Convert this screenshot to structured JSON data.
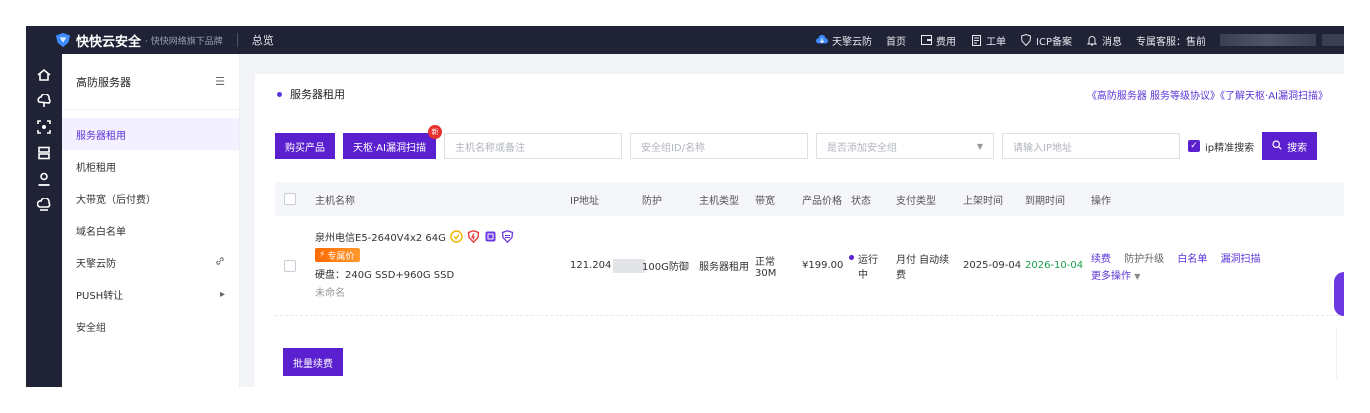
{
  "topbar": {
    "brand": "快快云安全",
    "brand_sub": "· 快快网络旗下品牌",
    "breadcrumb": "总览",
    "nav": [
      {
        "label": "天擎云防",
        "icon": "cloud-icon"
      },
      {
        "label": "首页",
        "icon": ""
      },
      {
        "label": "费用",
        "icon": "wallet-icon"
      },
      {
        "label": "工单",
        "icon": "doc-icon"
      },
      {
        "label": "ICP备案",
        "icon": "shield-icon"
      },
      {
        "label": "消息",
        "icon": "bell-icon"
      }
    ],
    "service_label": "专属客服：",
    "service_prefix": "售前"
  },
  "menu": {
    "title": "高防服务器",
    "items": [
      {
        "label": "服务器租用",
        "active": true,
        "suffix": ""
      },
      {
        "label": "机柜租用",
        "active": false,
        "suffix": ""
      },
      {
        "label": "大带宽（后付费）",
        "active": false,
        "suffix": ""
      },
      {
        "label": "域名白名单",
        "active": false,
        "suffix": ""
      },
      {
        "label": "天擎云防",
        "active": false,
        "suffix": "link"
      },
      {
        "label": "PUSH转让",
        "active": false,
        "suffix": "arrow"
      },
      {
        "label": "安全组",
        "active": false,
        "suffix": ""
      }
    ]
  },
  "section": {
    "title": "服务器租用",
    "links": "《高防服务器 服务等级协议》《了解天枢·AI漏洞扫描》"
  },
  "toolbar": {
    "buy_label": "购买产品",
    "scan_label": "天枢·AI漏洞扫描",
    "new_badge": "新",
    "host_placeholder": "主机名称或备注",
    "group_placeholder": "安全组ID/名称",
    "group_select": "是否添加安全组",
    "ip_placeholder": "请输入IP地址",
    "exact_label": "ip精准搜索",
    "search_label": "搜索"
  },
  "table": {
    "headers": [
      "主机名称",
      "IP地址",
      "防护",
      "主机类型",
      "带宽",
      "产品价格",
      "状态",
      "支付类型",
      "上架时间",
      "到期时间",
      "操作"
    ],
    "rows": [
      {
        "name": "泉州电信E5-2640V4x2 64G",
        "promo": "专属价",
        "disk": "硬盘：240G SSD+960G SSD",
        "remark": "未命名",
        "ip": "121.204",
        "defense": "100G防御",
        "type": "服务器租用",
        "bandwidth_1": "正常",
        "bandwidth_2": "30M",
        "price": "¥199.00",
        "status_1": "运行",
        "status_2": "中",
        "pay_1": "月付 自动续",
        "pay_2": "费",
        "start": "2025-09-04",
        "expire": "2026-10-04",
        "ops": [
          "续费",
          "防护升级",
          "白名单",
          "漏洞扫描"
        ],
        "more": "更多操作"
      }
    ]
  },
  "batch_label": "批量续费",
  "colors": {
    "accent": "#5a1fcf",
    "topbar": "#1f2335",
    "green": "#19a04b"
  }
}
